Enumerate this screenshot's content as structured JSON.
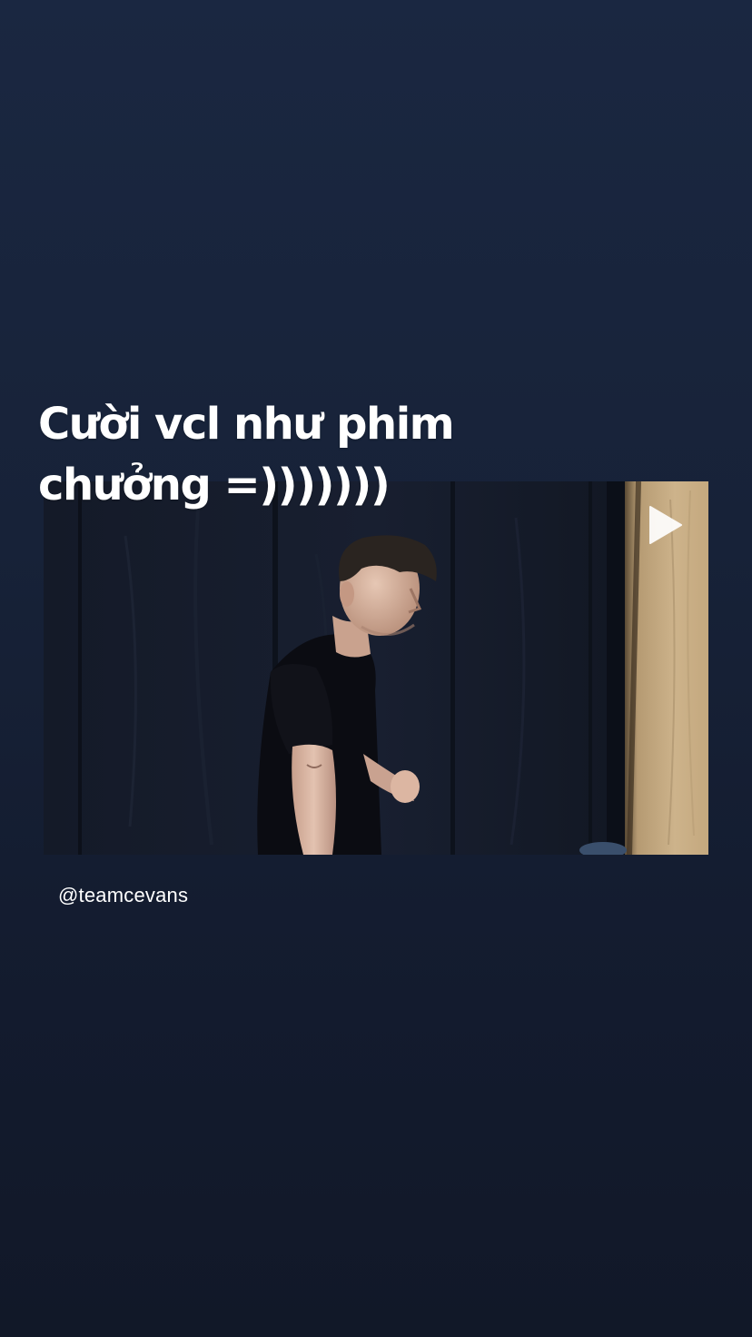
{
  "story": {
    "caption_lines": [
      "Cười vcl như phim",
      "chưởng =)))))))"
    ],
    "attribution": "@teamcevans"
  },
  "video": {
    "media_type": "video",
    "icon": "play-icon",
    "scene": "man in dark t-shirt in front of black padded wall with wooden panel"
  },
  "colors": {
    "background_top": "#1a2741",
    "background_bottom": "#111828",
    "text": "#ffffff"
  }
}
